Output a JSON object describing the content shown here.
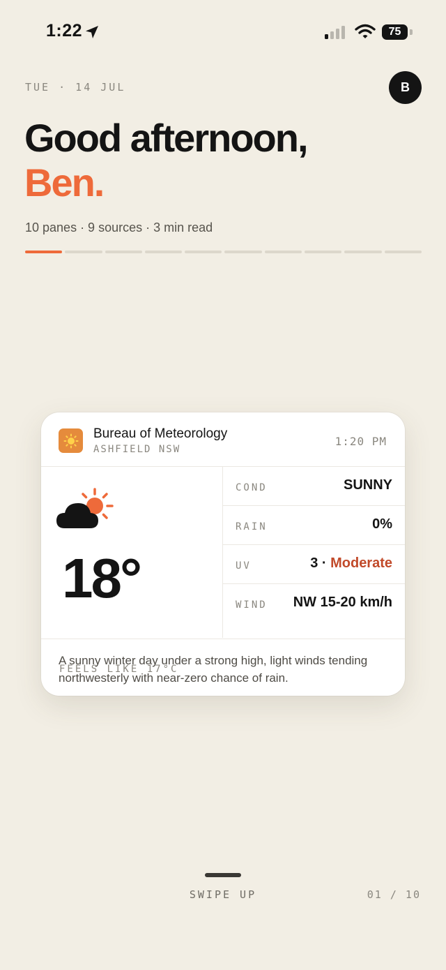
{
  "status_bar": {
    "time": "1:22",
    "battery": "75"
  },
  "header": {
    "date": "TUE · 14 JUL",
    "avatar_initial": "B",
    "greeting": "Good afternoon,",
    "name": "Ben.",
    "meta": "10 panes · 9 sources · 3 min read",
    "progress": {
      "current": 1,
      "total": 10
    }
  },
  "card": {
    "source_icon": "sun-icon",
    "source_name": "Bureau of Meteorology",
    "location": "ASHFIELD NSW",
    "time": "1:20 PM",
    "weather_icon": "partly-sunny-icon",
    "temperature": "18°",
    "feels_like": "FEELS LIKE 17°C",
    "stats": {
      "cond": {
        "label": "COND",
        "value": "SUNNY"
      },
      "rain": {
        "label": "RAIN",
        "value": "0%"
      },
      "uv": {
        "label": "UV",
        "index": "3 · ",
        "level": "Moderate"
      },
      "wind": {
        "label": "WIND",
        "value": "NW 15-20 km/h"
      }
    },
    "description": "A sunny winter day under a strong high, light winds tending northwesterly with near-zero chance of rain."
  },
  "footer": {
    "swipe_hint": "SWIPE UP",
    "pager": "01 / 10"
  },
  "colors": {
    "accent": "#ee6a3a",
    "background": "#f2eee4",
    "uv_moderate": "#c14a2a",
    "source_icon_bg": "#e58b3c"
  }
}
